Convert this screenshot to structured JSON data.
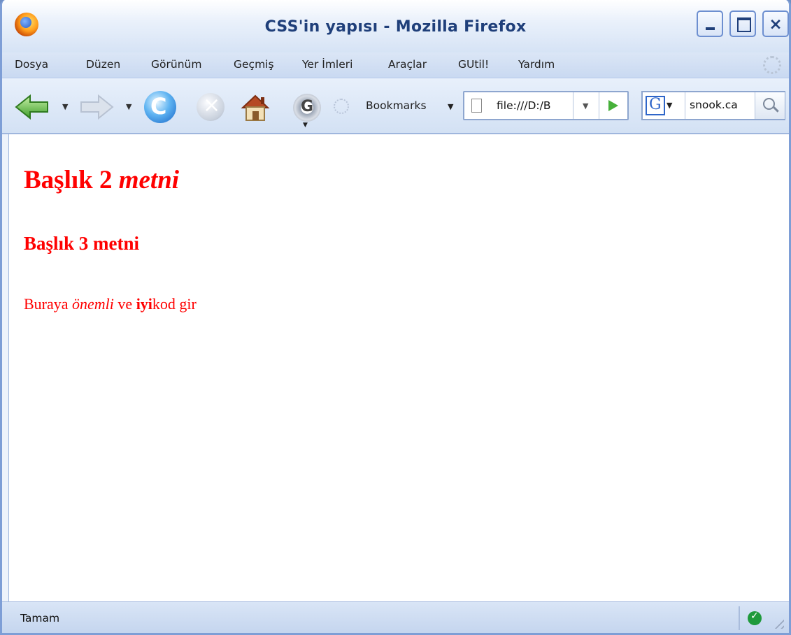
{
  "window": {
    "title": "CSS'in yapısı - Mozilla Firefox",
    "close_glyph": "×"
  },
  "menu": [
    "Dosya",
    "Düzen",
    "Görünüm",
    "Geçmiş",
    "Yer İmleri",
    "Araçlar",
    "GUtil!",
    "Yardım"
  ],
  "toolbar": {
    "bookmarks_label": "Bookmarks",
    "address": "file:///D:/B",
    "engine_letter": "G",
    "search_value": "snook.ca",
    "gear_letter": "G"
  },
  "page": {
    "h2_normal": "Başlık 2 ",
    "h2_italic": "metni",
    "h3": "Başlık 3 metni",
    "p_before": "Buraya ",
    "p_em": "önemli",
    "p_mid": " ve ",
    "p_strong": "iyi",
    "p_after": "kod gir"
  },
  "status": {
    "text": "Tamam",
    "ok_glyph": "✓"
  },
  "icons": {
    "back": "back-arrow-icon",
    "forward": "forward-arrow-icon",
    "reload": "reload-icon",
    "stop": "stop-icon",
    "home": "home-icon",
    "gear": "gear-icon",
    "search": "magnifier-icon"
  },
  "colors": {
    "heading_text": "#ff0000",
    "frame": "#7e9ed6",
    "toolbar": "#d3e1f4"
  }
}
